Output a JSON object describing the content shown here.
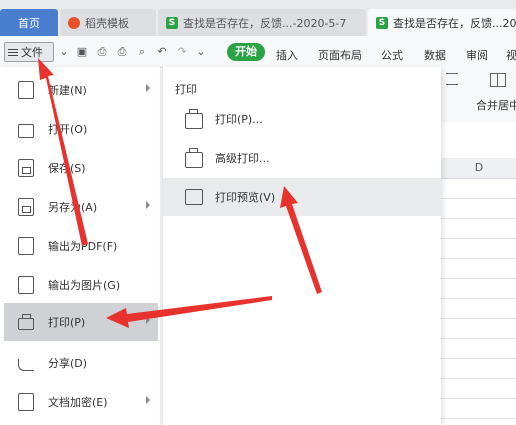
{
  "tabs": [
    {
      "label": "首页"
    },
    {
      "label": "稻壳模板"
    },
    {
      "label": "查找是否存在，反馈...-2020-5-7"
    },
    {
      "label": "查找是否存在，反馈...2020"
    }
  ],
  "file_button": {
    "label": "文件"
  },
  "start_button": {
    "label": "开始"
  },
  "menu": {
    "insert": "插入",
    "page_layout": "页面布局",
    "formula": "公式",
    "data": "数据",
    "review": "审阅",
    "view": "视"
  },
  "ribbon": {
    "merge_label": "合并居中"
  },
  "grid": {
    "column_d": "D"
  },
  "file_menu": {
    "items": [
      {
        "label": "新建(N)",
        "icon": "new-icon",
        "has_submenu": true
      },
      {
        "label": "打开(O)",
        "icon": "folder-icon",
        "has_submenu": false
      },
      {
        "label": "保存(S)",
        "icon": "save-icon",
        "has_submenu": false
      },
      {
        "label": "另存为(A)",
        "icon": "save-as-icon",
        "has_submenu": true
      },
      {
        "label": "输出为PDF(F)",
        "icon": "pdf-icon",
        "has_submenu": false
      },
      {
        "label": "输出为图片(G)",
        "icon": "image-icon",
        "has_submenu": false
      },
      {
        "label": "打印(P)",
        "icon": "printer-icon",
        "has_submenu": true,
        "active": true
      },
      {
        "label": "分享(D)",
        "icon": "share-icon",
        "has_submenu": false
      },
      {
        "label": "文档加密(E)",
        "icon": "encrypt-icon",
        "has_submenu": true
      }
    ]
  },
  "print_submenu": {
    "title": "打印",
    "items": [
      {
        "label": "打印(P)...",
        "icon": "printer-icon"
      },
      {
        "label": "高级打印...",
        "icon": "advanced-print-icon"
      },
      {
        "label": "打印预览(V)",
        "icon": "print-preview-icon",
        "active": true
      }
    ]
  },
  "colors": {
    "accent_green": "#2ba245",
    "home_tab_blue": "#4a7fcf",
    "arrow_red": "#e8322e"
  }
}
